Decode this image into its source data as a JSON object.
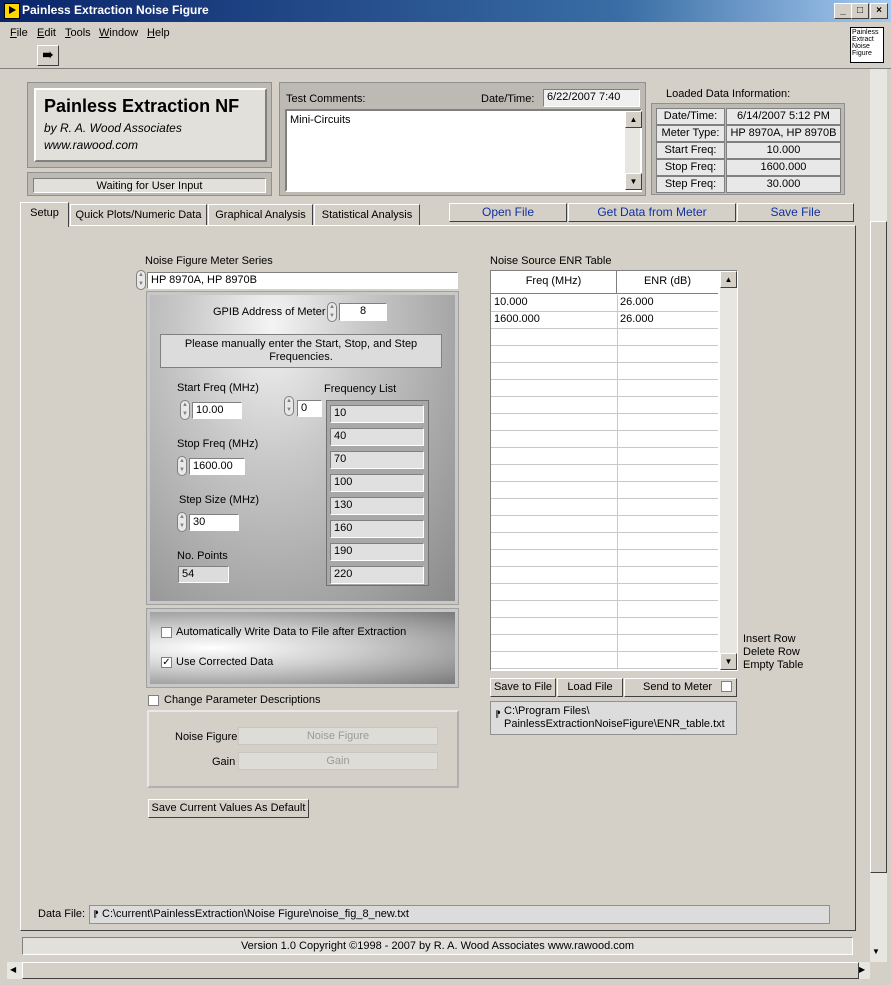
{
  "window": {
    "title": "Painless Extraction Noise Figure"
  },
  "menu": [
    "File",
    "Edit",
    "Tools",
    "Window",
    "Help"
  ],
  "corner_icon_text": "Painless Extract Noise Figure",
  "brand": {
    "title": "Painless Extraction NF",
    "author": "by R. A. Wood Associates",
    "url": "www.rawood.com"
  },
  "status": "Waiting for User Input",
  "comments": {
    "label": "Test Comments:",
    "datetime_label": "Date/Time:",
    "datetime_value": "6/22/2007  7:40",
    "text": "Mini-Circuits"
  },
  "loaded_info": {
    "title": "Loaded Data Information:",
    "rows": [
      {
        "label": "Date/Time:",
        "value": "6/14/2007  5:12 PM"
      },
      {
        "label": "Meter Type:",
        "value": "HP 8970A, HP 8970B"
      },
      {
        "label": "Start Freq:",
        "value": "10.000"
      },
      {
        "label": "Stop Freq:",
        "value": "1600.000"
      },
      {
        "label": "Step Freq:",
        "value": "30.000"
      }
    ]
  },
  "tabs": [
    "Setup",
    "Quick Plots/Numeric Data",
    "Graphical Analysis",
    "Statistical Analysis"
  ],
  "actions": {
    "open": "Open File",
    "get": "Get Data from Meter",
    "save": "Save File"
  },
  "setup": {
    "meter_series_label": "Noise Figure Meter Series",
    "meter_series_value": "HP 8970A, HP 8970B",
    "gpib_label": "GPIB Address of Meter",
    "gpib_value": "8",
    "instructions": "Please manually enter the Start, Stop, and Step Frequencies.",
    "start_label": "Start Freq (MHz)",
    "start_value": "10.00",
    "stop_label": "Stop Freq (MHz)",
    "stop_value": "1600.00",
    "step_label": "Step Size (MHz)",
    "step_value": "30",
    "npoints_label": "No. Points",
    "npoints_value": "54",
    "freq_list_label": "Frequency List",
    "freq_list_index": "0",
    "freq_list": [
      "10",
      "40",
      "70",
      "100",
      "130",
      "160",
      "190",
      "220"
    ],
    "auto_write_label": "Automatically Write Data to File after Extraction",
    "auto_write_checked": false,
    "use_corrected_label": "Use Corrected Data",
    "use_corrected_checked": true,
    "change_desc_label": "Change Parameter Descriptions",
    "change_desc_checked": false,
    "nf_label": "Noise Figure",
    "nf_value": "Noise Figure",
    "gain_label": "Gain",
    "gain_value": "Gain",
    "save_default": "Save Current Values As Default"
  },
  "enr": {
    "title": "Noise Source ENR Table",
    "headers": [
      "Freq (MHz)",
      "ENR (dB)"
    ],
    "rows": [
      [
        "10.000",
        "26.000"
      ],
      [
        "1600.000",
        "26.000"
      ]
    ],
    "save_btn": "Save to File",
    "load_btn": "Load File",
    "send_btn": "Send  to Meter",
    "path": "C:\\Program Files\\ PainlessExtractionNoiseFigure\\ENR_table.txt",
    "side_actions": [
      "Insert Row",
      "Delete Row",
      "Empty Table"
    ]
  },
  "data_file": {
    "label": "Data File:",
    "path": "C:\\current\\PainlessExtraction\\Noise Figure\\noise_fig_8_new.txt"
  },
  "footer": "Version 1.0 Copyright ©1998 - 2007 by R. A. Wood Associates www.rawood.com"
}
